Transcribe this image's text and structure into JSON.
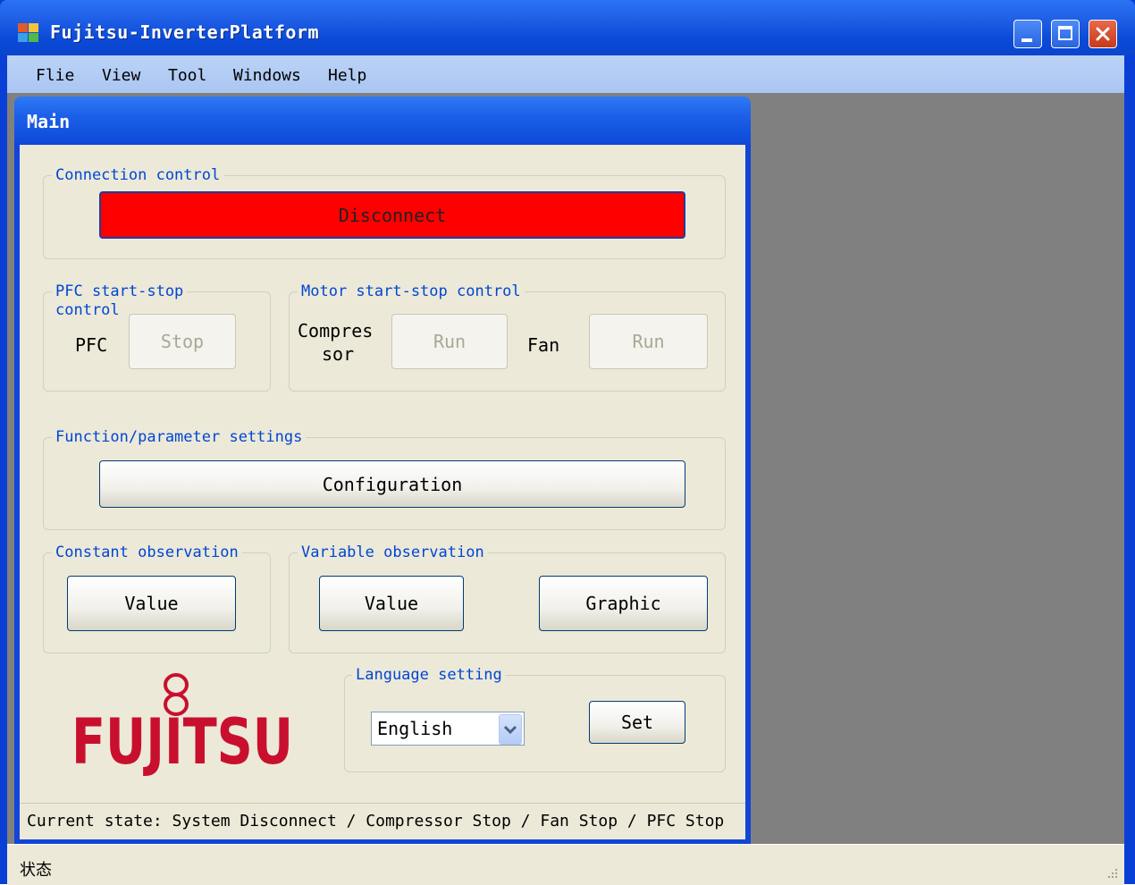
{
  "window": {
    "title": "Fujitsu-InverterPlatform",
    "controls": [
      "minimize-icon",
      "maximize-icon",
      "close-icon"
    ]
  },
  "menu": {
    "items": [
      "Flie",
      "View",
      "Tool",
      "Windows",
      "Help"
    ]
  },
  "main_form": {
    "title": "Main",
    "connection": {
      "group_label": "Connection control",
      "button_label": "Disconnect",
      "button_color": "#ff0000"
    },
    "pfc": {
      "group_label_line1": "PFC start-stop",
      "group_label_line2": "control",
      "label": "PFC",
      "button_label": "Stop"
    },
    "motor": {
      "group_label": "Motor start-stop control",
      "compressor_label_line1": "Compres",
      "compressor_label_line2": "sor",
      "compressor_button": "Run",
      "fan_label": "Fan",
      "fan_button": "Run"
    },
    "function": {
      "group_label": "Function/parameter settings",
      "button_label": "Configuration"
    },
    "constant_observation": {
      "group_label": "Constant observation",
      "value_button": "Value"
    },
    "variable_observation": {
      "group_label": "Variable observation",
      "value_button": "Value",
      "graphic_button": "Graphic"
    },
    "language": {
      "group_label": "Language setting",
      "selected": "English",
      "set_button": "Set"
    },
    "logo_text": "FUJITSU",
    "current_state": "Current state: System Disconnect / Compressor Stop / Fan Stop / PFC Stop"
  },
  "statusbar": {
    "label": "状态"
  },
  "colors": {
    "title_blue": "#0a45cc",
    "group_label_blue": "#0046d5",
    "mdi_gray": "#808080",
    "fujitsu_red": "#c8102e"
  }
}
